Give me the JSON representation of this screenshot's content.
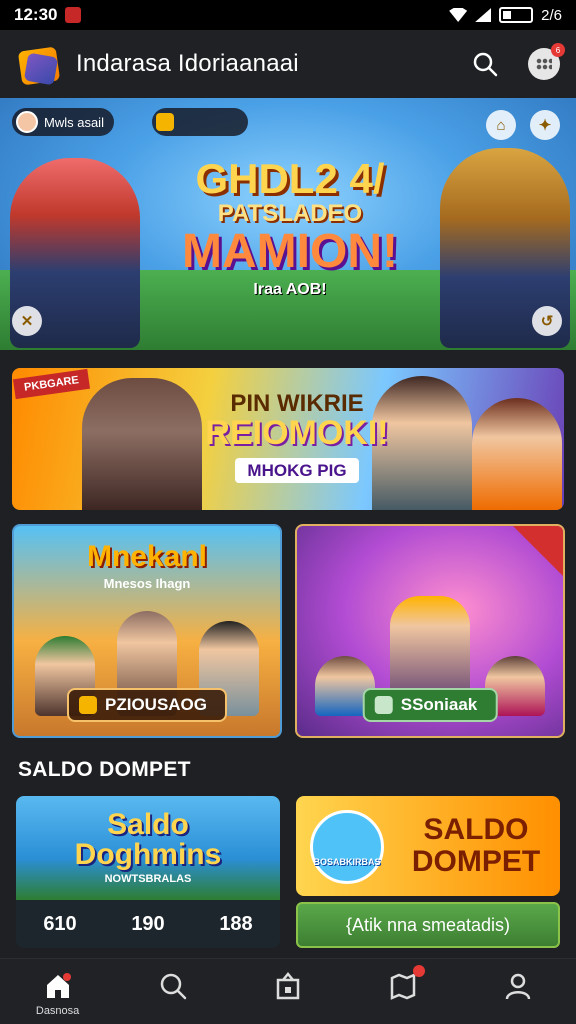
{
  "status_bar": {
    "time": "12:30",
    "battery": "2/6"
  },
  "app_bar": {
    "title": "Indarasa Idoriaanaai",
    "search_icon": "search-icon",
    "menu_icon": "grid-icon",
    "badge": "6"
  },
  "hero": {
    "player_name": "Mwls asail",
    "line1": "GHDL2 4/",
    "line2": "PATSLADEO",
    "line3": "MAMION!",
    "line4": "Iraa AOB!",
    "left_button": "✕",
    "right_button": "↺"
  },
  "banner": {
    "ribbon": "PKBGARE",
    "line1": "PIN WIKRIE",
    "line2": "REIOMOKI!",
    "tag": "MHOKG PIG"
  },
  "cards": [
    {
      "title": "Mnekanl",
      "subtitle": "Mnesos Ihagn",
      "button": "PZIOUSAOG"
    },
    {
      "title": "",
      "subtitle": "",
      "button": "SSoniaak"
    }
  ],
  "section_title": "SALDO DOMPET",
  "wallet_left": {
    "line1": "Saldo",
    "line2": "Doghmins",
    "line3": "NOWTSBRALAS",
    "stats": [
      "610",
      "190",
      "188"
    ]
  },
  "wallet_right": {
    "emblem_text": "BOSABKIRBAS",
    "line1": "SALDO",
    "line2": "DOMPET",
    "button": "{Atik nna smeatadis)"
  },
  "bottom_nav": [
    {
      "label": "Dasnosa",
      "icon": "home-icon"
    },
    {
      "label": "",
      "icon": "search-icon"
    },
    {
      "label": "",
      "icon": "bag-icon"
    },
    {
      "label": "",
      "icon": "map-icon"
    },
    {
      "label": "",
      "icon": "user-icon"
    }
  ]
}
